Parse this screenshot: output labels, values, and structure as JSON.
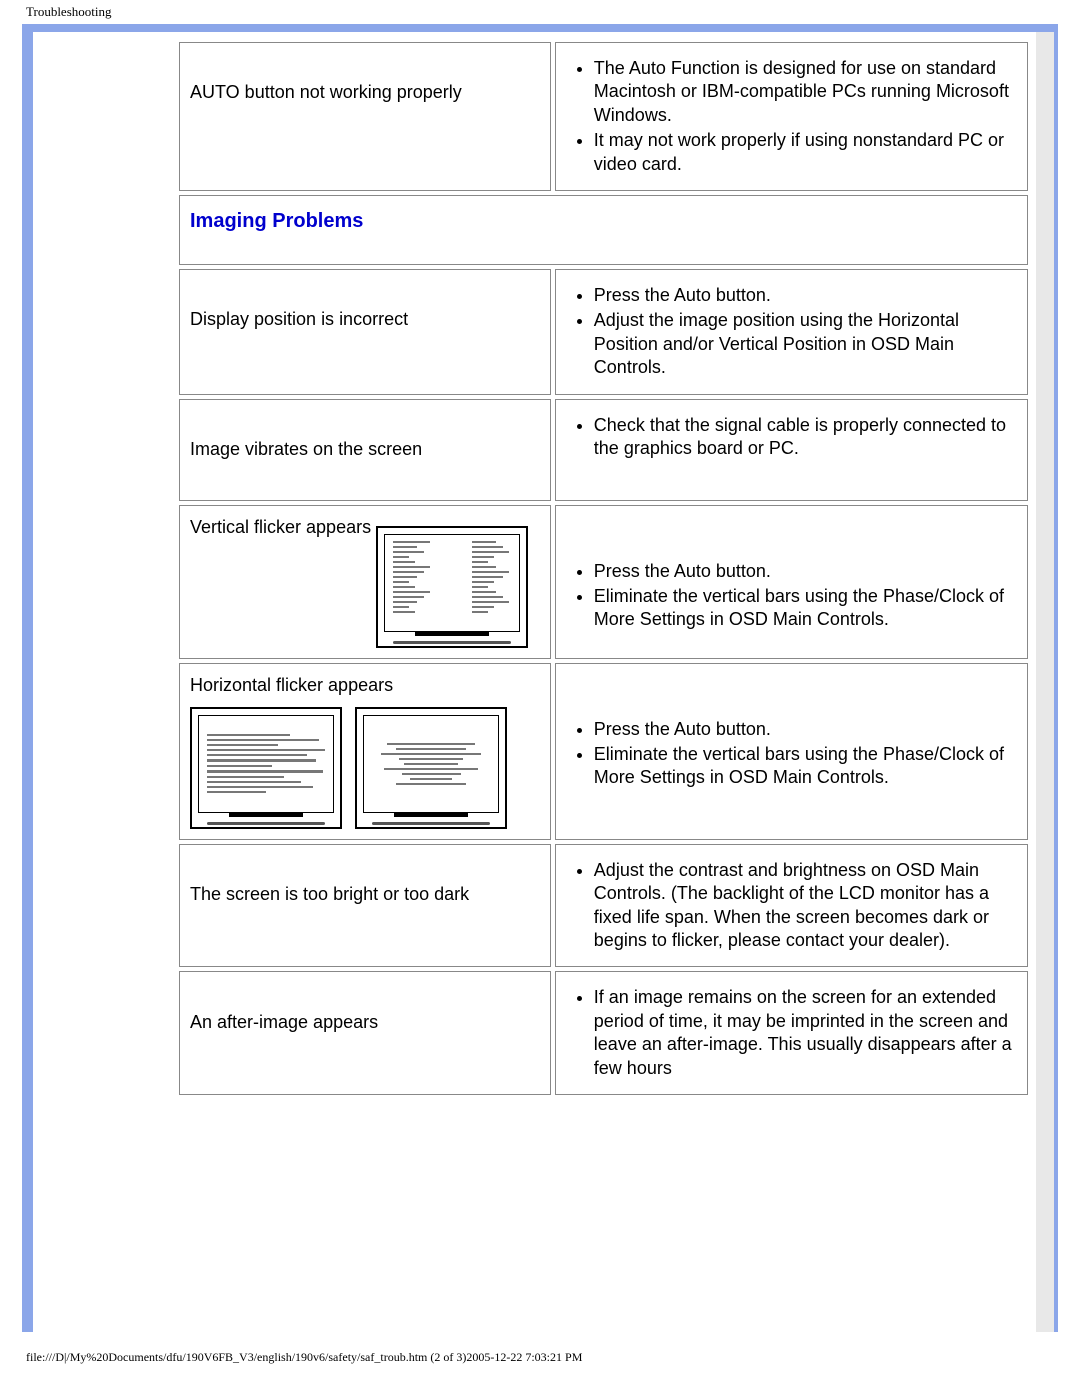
{
  "header": {
    "title": "Troubleshooting"
  },
  "rows": {
    "auto_button": {
      "label": "AUTO button not working properly",
      "items": [
        "The Auto Function is designed for use on standard Macintosh or IBM-compatible PCs running Microsoft Windows.",
        "It may not work properly if using nonstandard PC or video card."
      ]
    },
    "section": {
      "label": "Imaging Problems"
    },
    "display_position": {
      "label": "Display position is incorrect",
      "items": [
        "Press the Auto button.",
        "Adjust the image position using the Horizontal Position and/or Vertical Position in OSD Main Controls."
      ]
    },
    "image_vibrates": {
      "label": "Image vibrates on the screen",
      "items": [
        "Check that the signal cable is properly connected to the graphics board or PC."
      ]
    },
    "vertical_flicker": {
      "label": "Vertical flicker appears",
      "items": [
        "Press the Auto button.",
        "Eliminate the vertical bars using the Phase/Clock of More Settings in OSD Main Controls."
      ]
    },
    "horizontal_flicker": {
      "label": "Horizontal flicker appears",
      "items": [
        "Press the Auto button.",
        "Eliminate the vertical bars using the Phase/Clock of More Settings in OSD Main Controls."
      ]
    },
    "bright_dark": {
      "label": "The screen is too bright or too dark",
      "items": [
        "Adjust the contrast and brightness on OSD Main Controls. (The backlight of the LCD monitor has a fixed life span. When the screen becomes dark or begins to flicker, please contact your dealer)."
      ]
    },
    "after_image": {
      "label": "An after-image appears",
      "items": [
        "If an image remains on the screen for an extended period of time, it may be imprinted in the screen and leave an after-image. This usually disappears after a few hours"
      ]
    }
  },
  "footer": {
    "path": "file:///D|/My%20Documents/dfu/190V6FB_V3/english/190v6/safety/saf_troub.htm (2 of 3)2005-12-22 7:03:21 PM"
  }
}
